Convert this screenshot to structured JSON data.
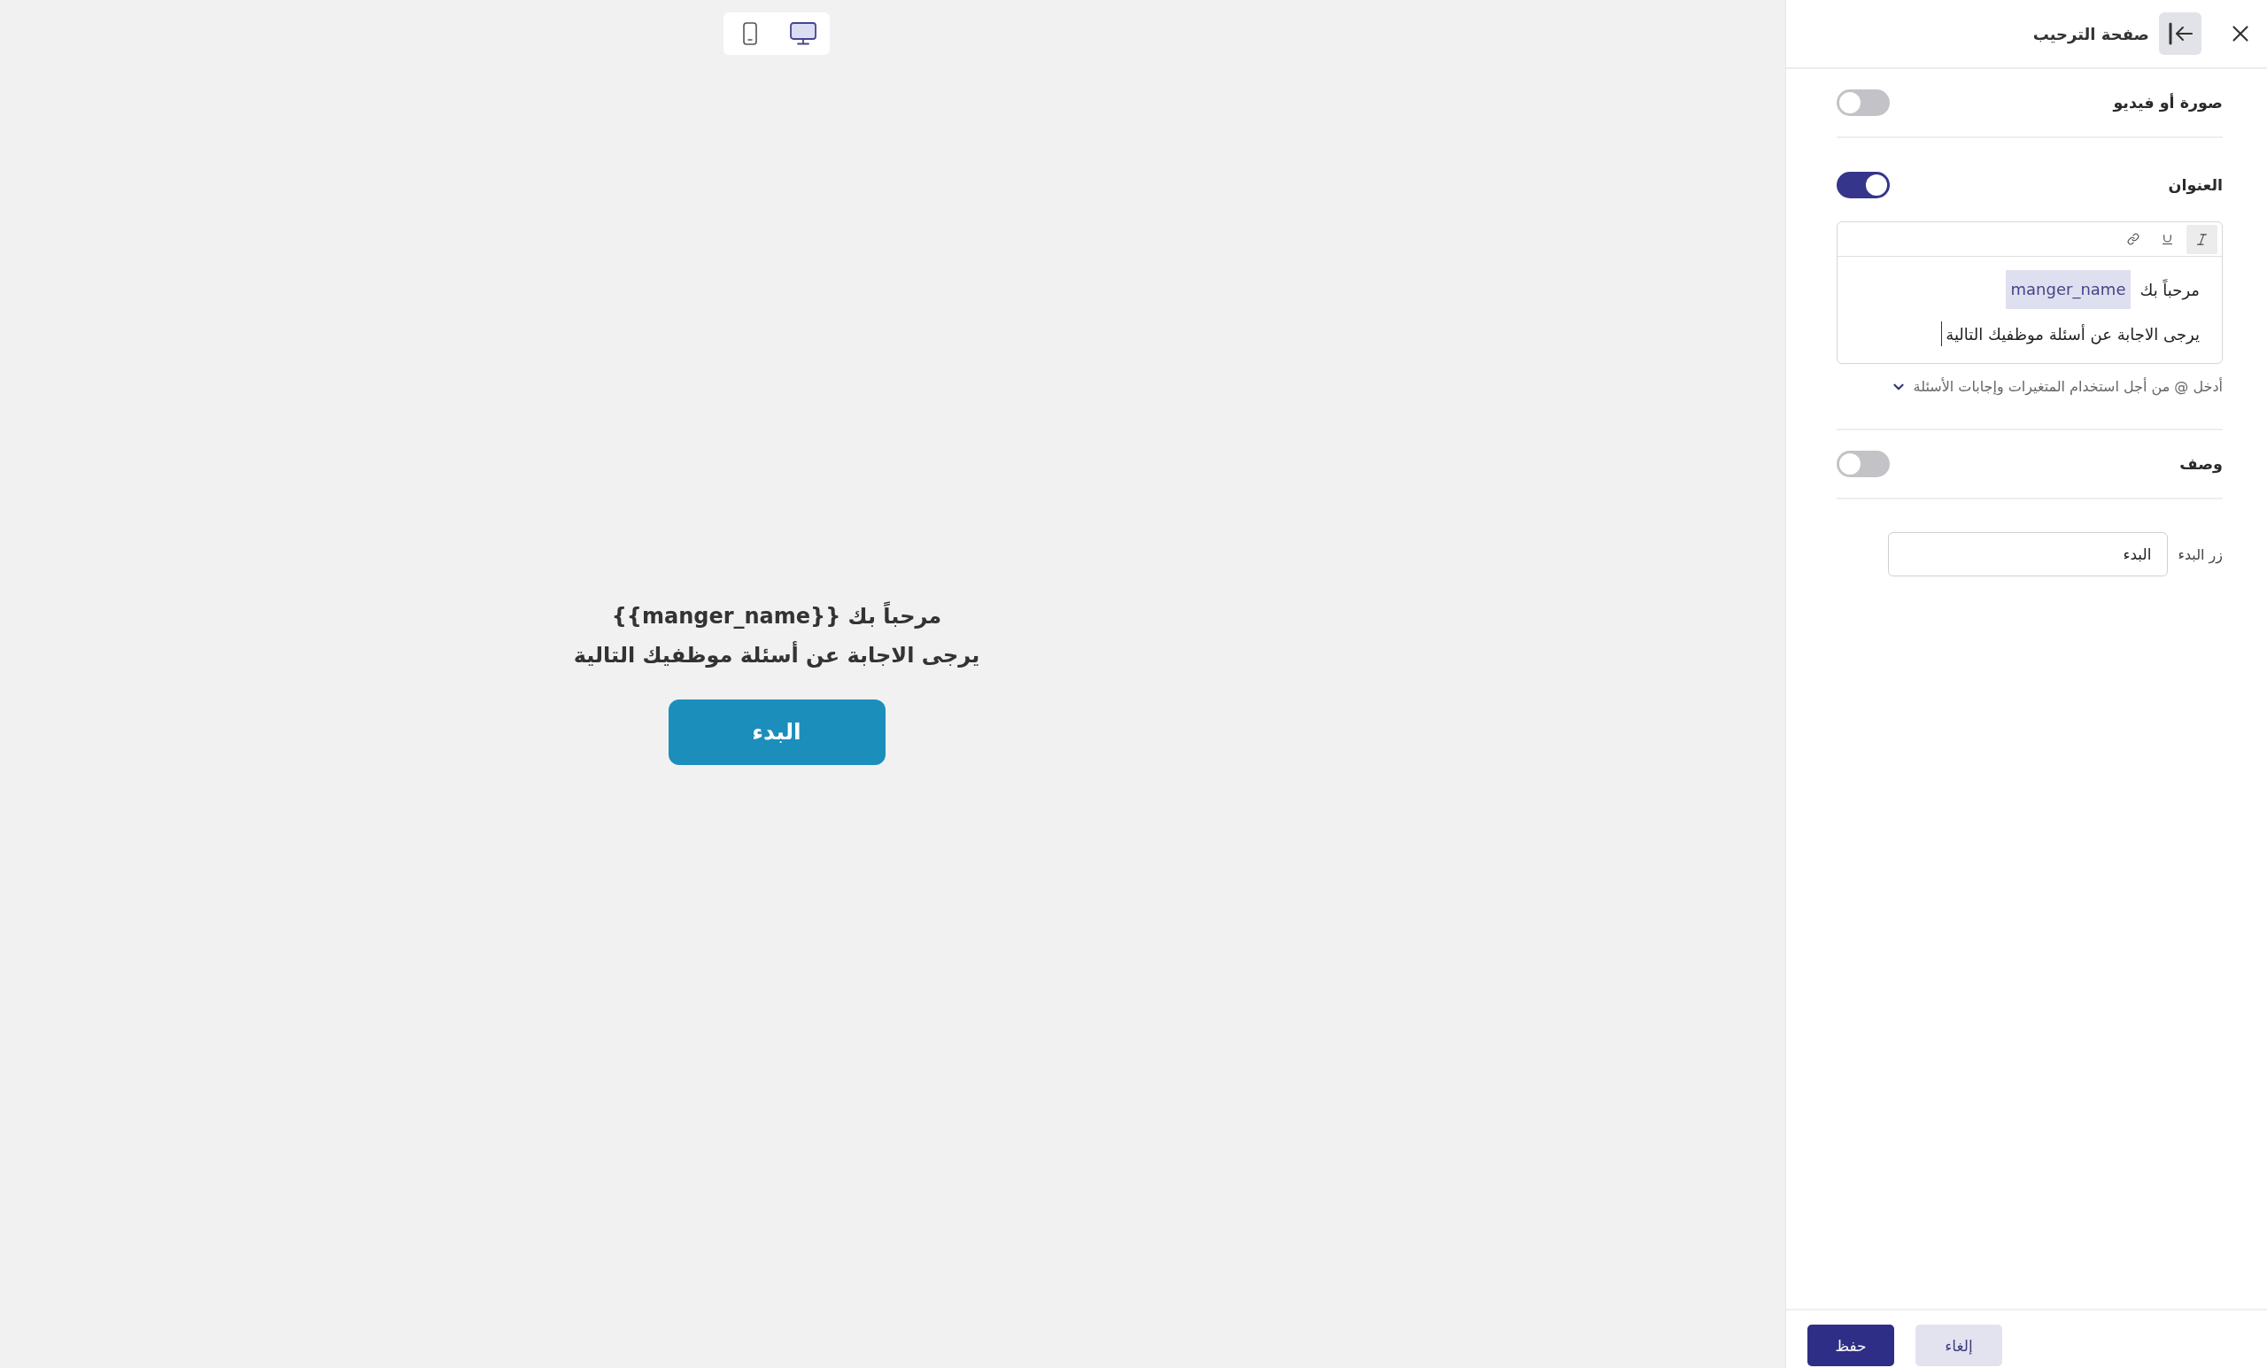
{
  "device_switcher": [
    {
      "kind": "mobile",
      "selected": false
    },
    {
      "kind": "desktop",
      "selected": true
    }
  ],
  "preview": {
    "title_lines": [
      "مرحباً بك {{manger_name}}",
      "يرجى الاجابة عن أسئلة موظفيك التالية"
    ],
    "start_button": "البدء"
  },
  "panel": {
    "title": "صفحة الترحيب",
    "sections": [
      {
        "kind": "toggle",
        "label": "صورة أو فيديو",
        "on": false
      },
      {
        "kind": "toggle",
        "label": "العنوان",
        "on": true,
        "editor": {
          "toolbar": [
            {
              "kind": "italic",
              "selected": true
            },
            {
              "kind": "underline",
              "selected": false
            },
            {
              "kind": "link",
              "selected": false
            }
          ],
          "lines": [
            {
              "text": "مرحباً بك",
              "variable": "manger_name",
              "focused": false
            },
            {
              "text": "يرجى الاجابة عن أسئلة موظفيك التالية",
              "focused": true
            }
          ],
          "hint": {
            "text": "أدخل @ من أجل استخدام المتغيرات وإجابات الأسئلة",
            "expanded": false
          }
        }
      },
      {
        "kind": "toggle",
        "label": "وصف",
        "on": false
      },
      {
        "kind": "field",
        "label": "زر البدء",
        "value": "البدء"
      }
    ],
    "footer_buttons": [
      {
        "kind": "secondary",
        "label": "إلغاء"
      },
      {
        "kind": "primary",
        "label": "حفظ"
      }
    ]
  }
}
